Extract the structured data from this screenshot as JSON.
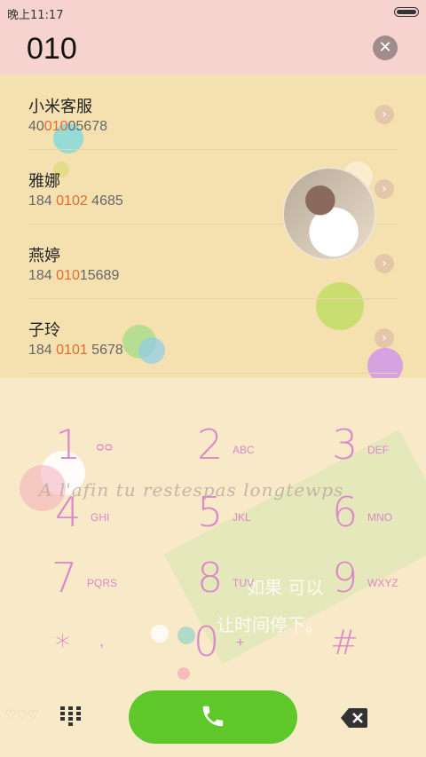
{
  "statusbar": {
    "time": "晚上11:17"
  },
  "search": {
    "query": "010"
  },
  "contacts": [
    {
      "name": "小米客服",
      "num_pre": "40",
      "num_hl": "010",
      "num_post": "05678"
    },
    {
      "name": "雅娜",
      "num_pre": "184 ",
      "num_hl": "0102",
      "num_post": " 4685"
    },
    {
      "name": "燕婷",
      "num_pre": "184 ",
      "num_hl": "010",
      "num_post": "15689"
    },
    {
      "name": "子玲",
      "num_pre": "184 ",
      "num_hl": "0101",
      "num_post": " 5678"
    }
  ],
  "keys": [
    {
      "digit": "1",
      "letters": ""
    },
    {
      "digit": "2",
      "letters": "ABC"
    },
    {
      "digit": "3",
      "letters": "DEF"
    },
    {
      "digit": "4",
      "letters": "GHI"
    },
    {
      "digit": "5",
      "letters": "JKL"
    },
    {
      "digit": "6",
      "letters": "MNO"
    },
    {
      "digit": "7",
      "letters": "PQRS"
    },
    {
      "digit": "8",
      "letters": "TUV"
    },
    {
      "digit": "9",
      "letters": "WXYZ"
    },
    {
      "digit": "*",
      "letters": ","
    },
    {
      "digit": "0",
      "letters": "+"
    },
    {
      "digit": "#",
      "letters": ""
    }
  ],
  "wallpaper_text": {
    "line1": "A l'afin tu restespas longtewps",
    "line2": "如果 可以",
    "line3": "让时间停下。"
  },
  "icons": {
    "clear": "clear-icon",
    "chevron": "chevron-right-icon",
    "call": "phone-icon",
    "grid": "dialpad-toggle-icon",
    "backspace": "backspace-icon"
  },
  "colors": {
    "accent_green": "#5ec72a",
    "highlight_orange": "#e36a2f",
    "digit_pink": "#dd88c8"
  }
}
